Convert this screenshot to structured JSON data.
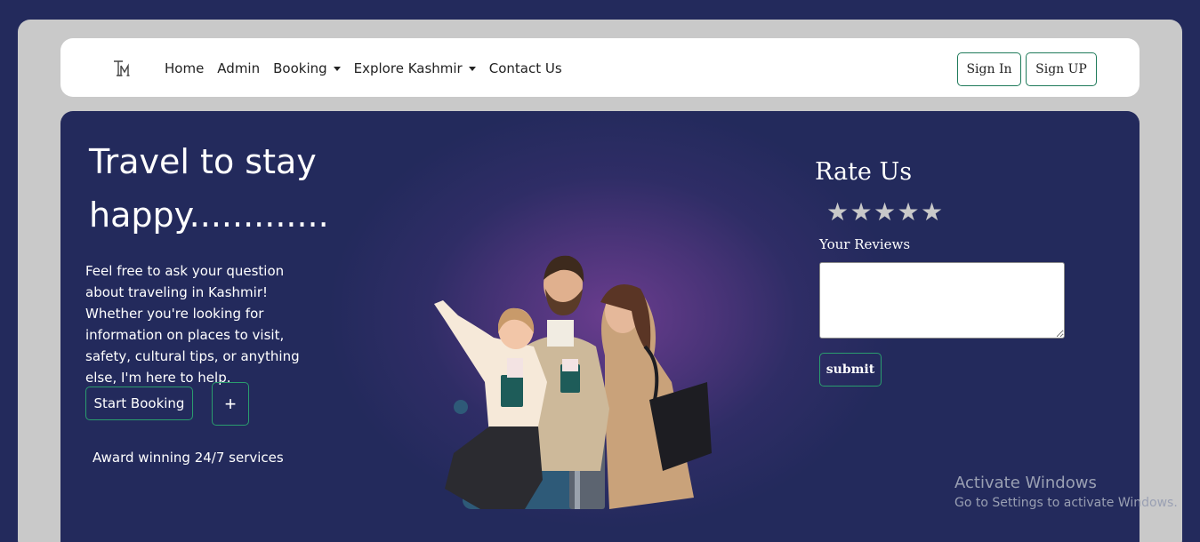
{
  "brand": {
    "logo_icon": "tm-monogram-logo"
  },
  "nav": {
    "items": [
      {
        "label": "Home",
        "dropdown": false
      },
      {
        "label": "Admin",
        "dropdown": false
      },
      {
        "label": "Booking",
        "dropdown": true
      },
      {
        "label": "Explore Kashmir",
        "dropdown": true
      },
      {
        "label": "Contact Us",
        "dropdown": false
      }
    ],
    "sign_in": "Sign In",
    "sign_up": "Sign UP"
  },
  "hero": {
    "title": "Travel to stay happy.............",
    "text": "Feel free to ask your question about traveling in Kashmir! Whether you're looking for information on places to visit, safety, cultural tips, or anything else, I'm here to help.",
    "start_booking": "Start Booking",
    "plus": "+",
    "award": "Award winning 24/7 services"
  },
  "rating": {
    "title": "Rate Us",
    "stars": [
      "★",
      "★",
      "★",
      "★",
      "★"
    ],
    "reviews_label": "Your Reviews",
    "review_value": "",
    "submit": "submit"
  },
  "windows_notice": {
    "title": "Activate Windows",
    "subtitle": "Go to Settings to activate Windows."
  },
  "colors": {
    "page_bg": "#232a5c",
    "frame_bg": "#c9c9c9",
    "accent_border": "#2a9d6e",
    "glow": "#6a3d8e"
  }
}
